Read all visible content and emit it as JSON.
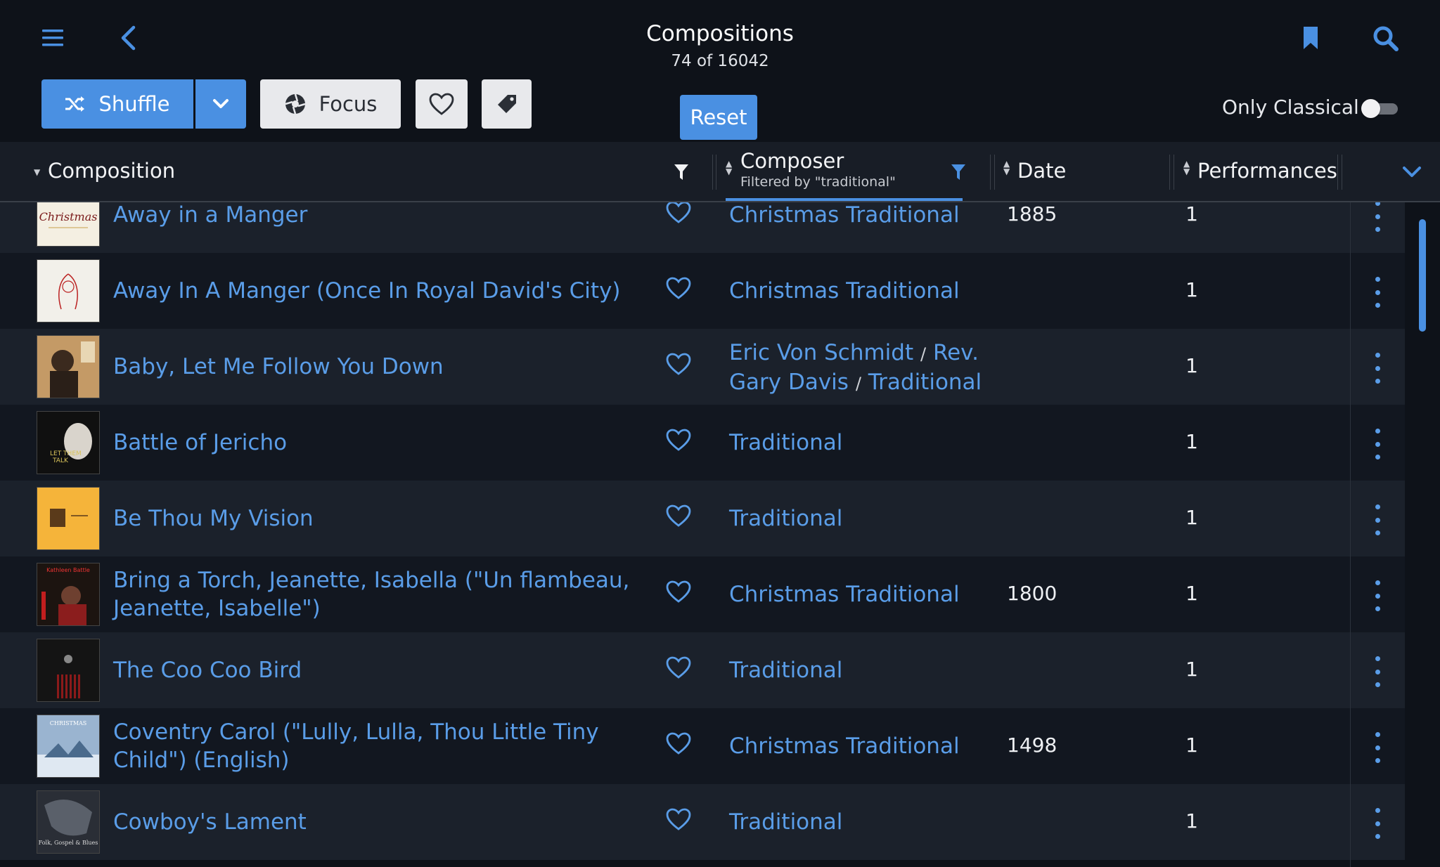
{
  "header": {
    "title": "Compositions",
    "subtitle": "74 of 16042"
  },
  "toolbar": {
    "shuffle_label": "Shuffle",
    "focus_label": "Focus",
    "reset_label": "Reset",
    "only_classical_label": "Only Classical",
    "only_classical_on": false
  },
  "columns": {
    "composition": "Composition",
    "composer": "Composer",
    "composer_filter": "Filtered by \"traditional\"",
    "date": "Date",
    "performances": "Performances"
  },
  "colors": {
    "accent": "#4a90e2",
    "link": "#5a9de8",
    "background": "#0e1219"
  },
  "rows": [
    {
      "title": "Away in a Manger",
      "composers": [
        "Christmas Traditional"
      ],
      "date": "1885",
      "performances": "1"
    },
    {
      "title": "Away In A Manger (Once In Royal David's City)",
      "composers": [
        "Christmas Traditional"
      ],
      "date": "",
      "performances": "1"
    },
    {
      "title": "Baby, Let Me Follow You Down",
      "composers": [
        "Eric Von Schmidt",
        "Rev. Gary Davis",
        "Traditional"
      ],
      "date": "",
      "performances": "1"
    },
    {
      "title": "Battle of Jericho",
      "composers": [
        "Traditional"
      ],
      "date": "",
      "performances": "1"
    },
    {
      "title": "Be Thou My Vision",
      "composers": [
        "Traditional"
      ],
      "date": "",
      "performances": "1"
    },
    {
      "title": "Bring a Torch, Jeanette, Isabella (\"Un flambeau, Jeanette, Isabelle\")",
      "composers": [
        "Christmas Traditional"
      ],
      "date": "1800",
      "performances": "1"
    },
    {
      "title": "The Coo Coo Bird",
      "composers": [
        "Traditional"
      ],
      "date": "",
      "performances": "1"
    },
    {
      "title": "Coventry Carol (\"Lully, Lulla, Thou Little Tiny Child\") (English)",
      "composers": [
        "Christmas Traditional"
      ],
      "date": "1498",
      "performances": "1"
    },
    {
      "title": "Cowboy's Lament",
      "composers": [
        "Traditional"
      ],
      "date": "",
      "performances": "1"
    }
  ],
  "icons": [
    "menu-icon",
    "back-icon",
    "bookmark-icon",
    "search-icon",
    "shuffle-icon",
    "chevron-down-icon",
    "focus-icon",
    "heart-icon",
    "tag-icon",
    "filter-icon",
    "sort-icon",
    "more-vertical-icon"
  ]
}
